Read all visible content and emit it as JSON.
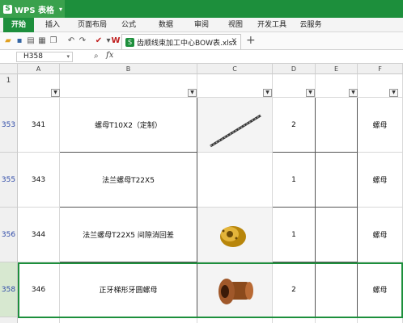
{
  "app": {
    "title": "WPS 表格"
  },
  "menu": {
    "items": [
      "开始",
      "插入",
      "页面布局",
      "公式",
      "数据",
      "审阅",
      "视图",
      "开发工具",
      "云服务"
    ]
  },
  "document_tab": {
    "filename": "齿顺线束加工中心BOW表.xlsx"
  },
  "formula_bar": {
    "cell_ref": "H358",
    "fx_label": "fx",
    "formula": ""
  },
  "columns": [
    "A",
    "B",
    "C",
    "D",
    "E",
    "F"
  ],
  "header_row": {
    "number": "1"
  },
  "rows": [
    {
      "row_num": "353",
      "seq": "341",
      "name": "螺母T10X2（定制）",
      "image": "lead-screw",
      "qty": "2",
      "e": "",
      "type": "螺母"
    },
    {
      "row_num": "355",
      "seq": "343",
      "name": "法兰螺母T22X5",
      "image": "none",
      "qty": "1",
      "e": "",
      "type": "螺母"
    },
    {
      "row_num": "356",
      "seq": "344",
      "name": "法兰螺母T22X5  间隙消回差",
      "image": "brass-nut",
      "qty": "1",
      "e": "",
      "type": "螺母"
    },
    {
      "row_num": "358",
      "seq": "346",
      "name": "正牙梯形牙圆螺母",
      "image": "bronze-flange-nut",
      "qty": "2",
      "e": "",
      "type": "螺母"
    }
  ]
}
